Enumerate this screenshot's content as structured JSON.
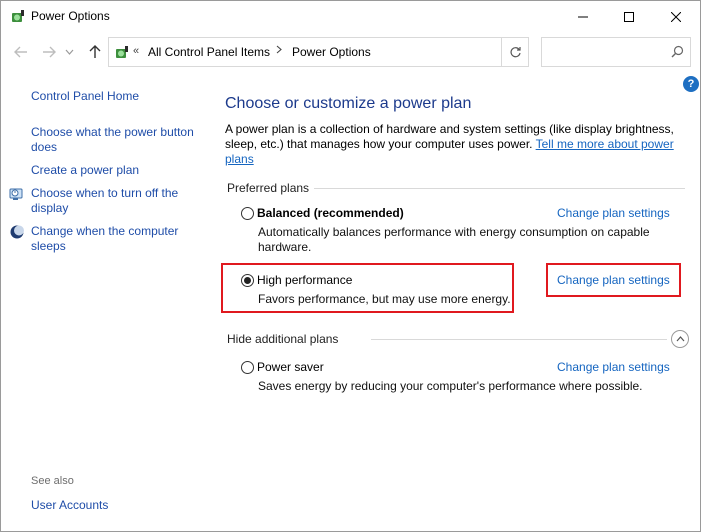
{
  "window": {
    "title": "Power Options",
    "icon": "power-options-icon",
    "controls": [
      "minimize-icon",
      "maximize-icon",
      "close-icon"
    ]
  },
  "navigation": {
    "overflow": "«",
    "breadcrumb": [
      "All Control Panel Items",
      "Power Options"
    ],
    "search_placeholder": ""
  },
  "help_label": "?",
  "sidebar": {
    "home": "Control Panel Home",
    "links": [
      {
        "label": "Choose what the power button does",
        "icon": ""
      },
      {
        "label": "Create a power plan",
        "icon": ""
      },
      {
        "label": "Choose when to turn off the display",
        "icon": "display-clock-icon"
      },
      {
        "label": "Change when the computer sleeps",
        "icon": "moon-icon"
      }
    ],
    "see_also_label": "See also",
    "see_also_links": [
      "User Accounts"
    ]
  },
  "main": {
    "title": "Choose or customize a power plan",
    "intro_text": "A power plan is a collection of hardware and system settings (like display brightness, sleep, etc.) that manages how your computer uses power.",
    "intro_link": "Tell me more about power plans",
    "preferred_label": "Preferred plans",
    "hidden_label": "Hide additional plans",
    "plans": [
      {
        "name": "Balanced (recommended)",
        "description": "Automatically balances performance with energy consumption on capable hardware.",
        "selected": false,
        "link": "Change plan settings"
      },
      {
        "name": "High performance",
        "description": "Favors performance, but may use more energy.",
        "selected": true,
        "link": "Change plan settings"
      },
      {
        "name": "Power saver",
        "description": "Saves energy by reducing your computer's performance where possible.",
        "selected": false,
        "link": "Change plan settings"
      }
    ]
  },
  "colors": {
    "link": "#1565c0",
    "title": "#1c3a8c",
    "highlight": "#e0191f"
  }
}
